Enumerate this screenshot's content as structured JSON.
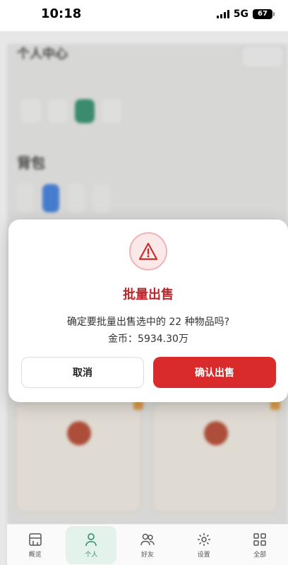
{
  "status_bar": {
    "time": "10:18",
    "network": "5G",
    "battery": "67"
  },
  "background": {
    "title": "个人中心",
    "subtitle": "",
    "top_button": "",
    "tabs": [
      "",
      "",
      "",
      ""
    ],
    "section_title": "背包",
    "section_note": "",
    "filters": [
      "",
      "",
      "",
      ""
    ],
    "cards": [
      {
        "name": "",
        "desc": "",
        "price": ""
      },
      {
        "name": "",
        "desc": "",
        "price": ""
      }
    ]
  },
  "modal": {
    "title": "批量出售",
    "message": "确定要批量出售选中的 22 种物品吗?",
    "gold": "金币：5934.30万",
    "cancel_label": "取消",
    "confirm_label": "确认出售",
    "accent_color": "#d92b2b"
  },
  "bottom_nav": {
    "items": [
      {
        "label": "概览",
        "icon": "overview-icon"
      },
      {
        "label": "个人",
        "icon": "person-icon",
        "active": true
      },
      {
        "label": "好友",
        "icon": "friends-icon"
      },
      {
        "label": "设置",
        "icon": "gear-icon"
      },
      {
        "label": "全部",
        "icon": "grid-icon"
      }
    ]
  }
}
